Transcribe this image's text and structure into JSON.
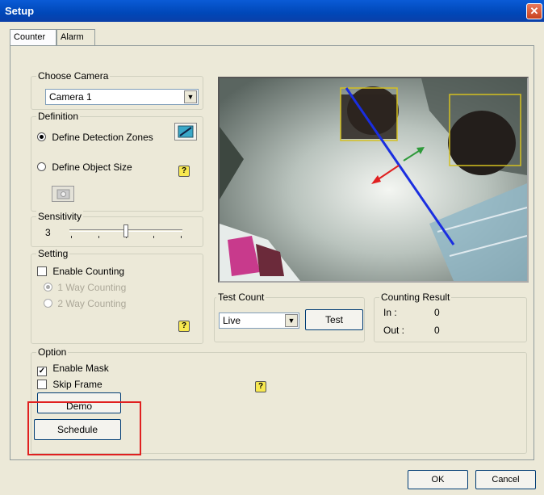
{
  "window": {
    "title": "Setup",
    "close_glyph": "✕"
  },
  "tabs": [
    {
      "label": "Counter",
      "active": true
    },
    {
      "label": "Alarm",
      "active": false
    }
  ],
  "choose_camera": {
    "legend": "Choose Camera",
    "selected": "Camera 1"
  },
  "definition": {
    "legend": "Definition",
    "option_zones": "Define Detection Zones",
    "option_size": "Define Object Size",
    "selected": "zones"
  },
  "sensitivity": {
    "legend": "Sensitivity",
    "value": "3",
    "level_fraction": 0.5
  },
  "setting": {
    "legend": "Setting",
    "enable_counting": "Enable Counting",
    "enable_counting_checked": false,
    "one_way": "1 Way Counting",
    "two_way": "2 Way Counting",
    "selected": "one_way"
  },
  "test_count": {
    "legend": "Test Count",
    "selected": "Live",
    "test_button": "Test"
  },
  "counting_result": {
    "legend": "Counting Result",
    "in_label": "In :",
    "in_value": "0",
    "out_label": "Out :",
    "out_value": "0"
  },
  "option": {
    "legend": "Option",
    "enable_mask": "Enable Mask",
    "enable_mask_checked": true,
    "skip_frame": "Skip Frame",
    "skip_frame_checked": false,
    "demo_button": "Demo",
    "schedule_button": "Schedule"
  },
  "footer": {
    "ok": "OK",
    "cancel": "Cancel"
  },
  "icons": {
    "help": "?",
    "dropdown": "▼"
  },
  "colors": {
    "titlebar": "#0047b8",
    "highlight": "#e02020",
    "counting_line": "#1a2ee0",
    "detection_box": "#d4c020"
  }
}
